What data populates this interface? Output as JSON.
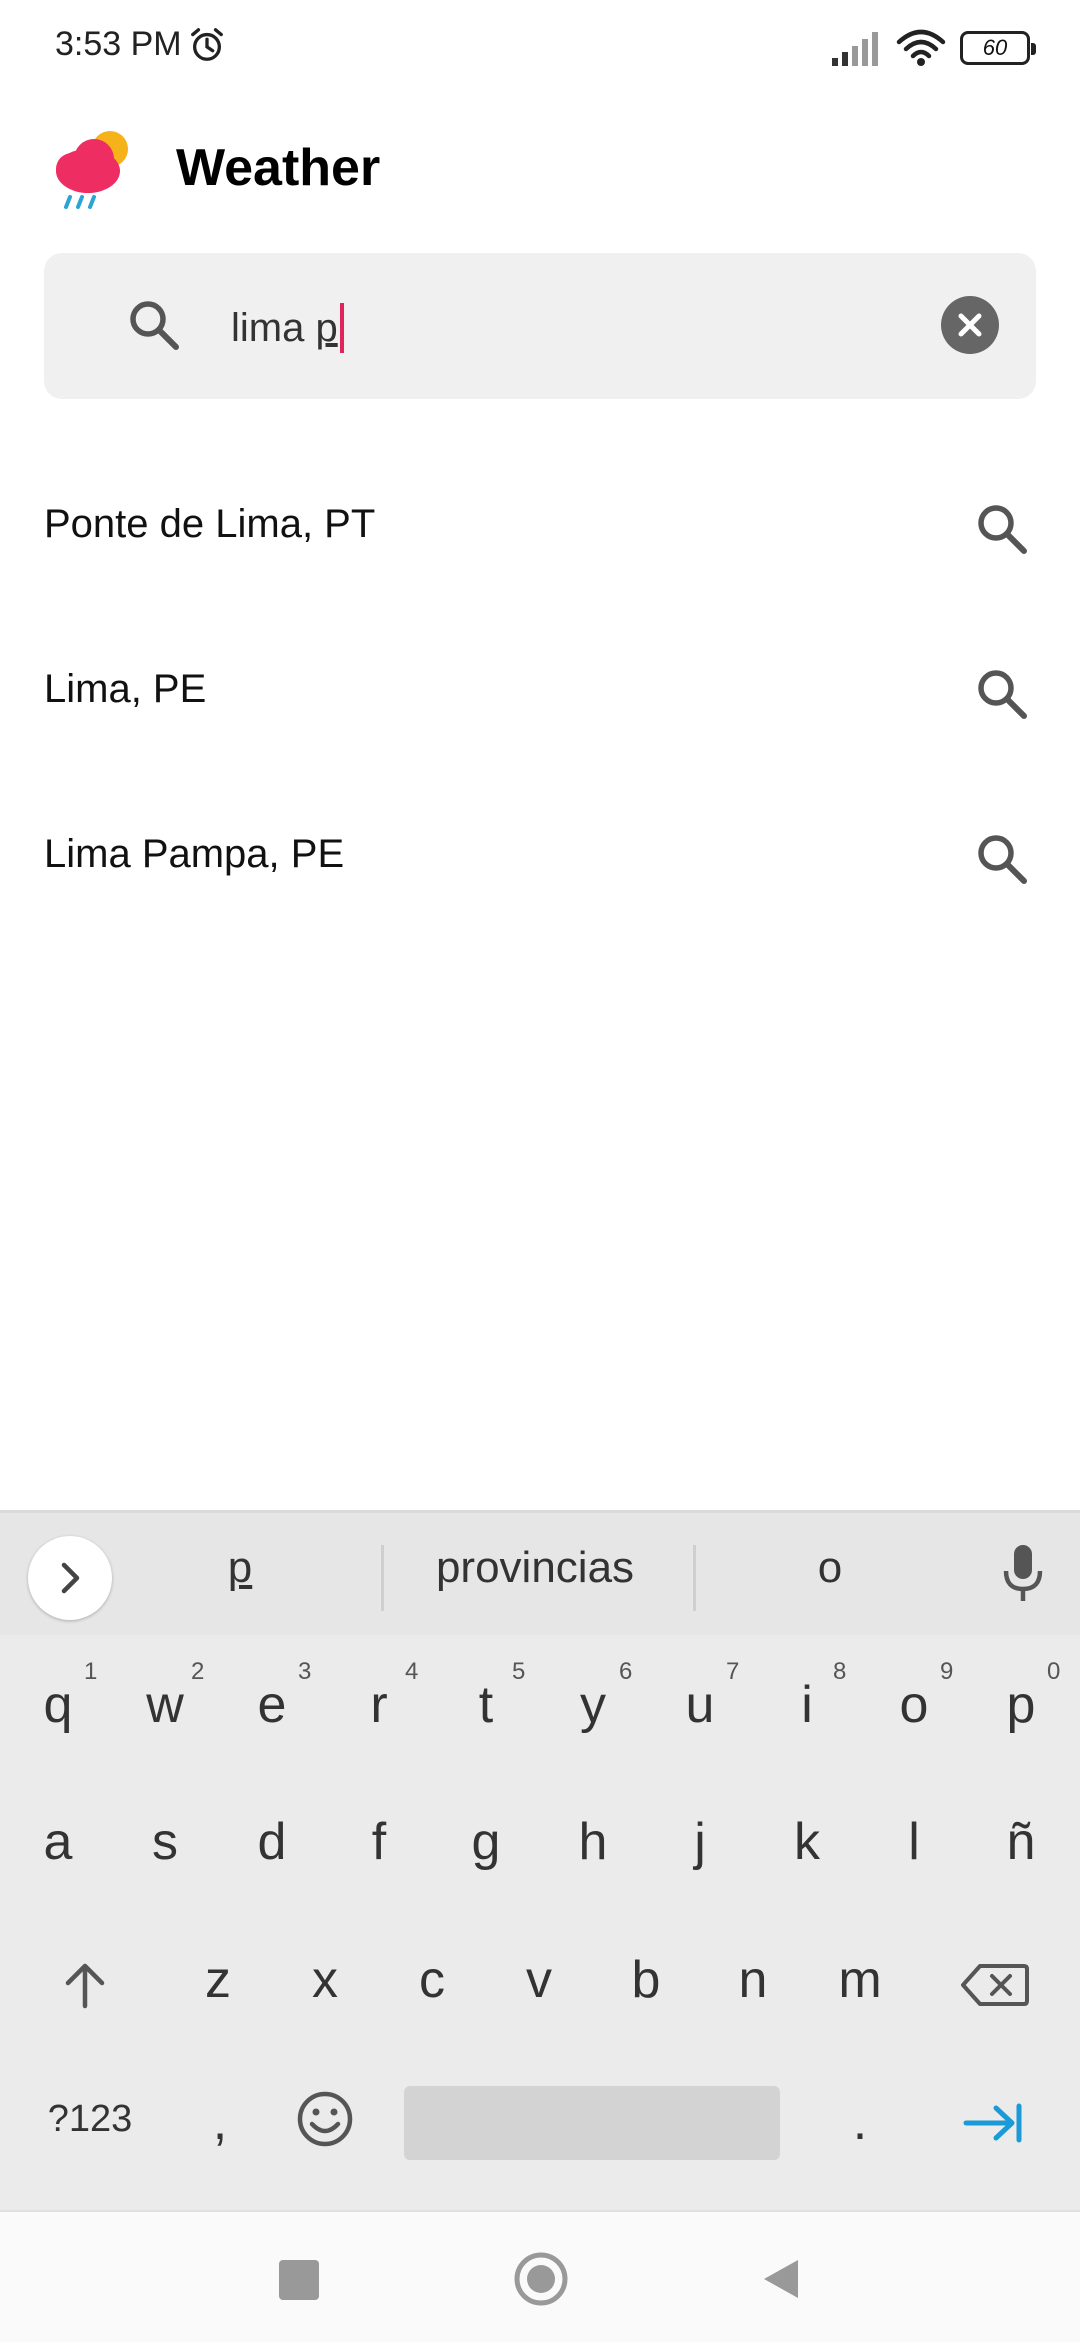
{
  "status_bar": {
    "time": "3:53 PM",
    "battery": "60"
  },
  "header": {
    "title": "Weather"
  },
  "search": {
    "value": "lima ",
    "value_underlined": "p"
  },
  "results": [
    {
      "label": "Ponte de Lima, PT"
    },
    {
      "label": "Lima, PE"
    },
    {
      "label": "Lima Pampa, PE"
    }
  ],
  "keyboard": {
    "suggestions": [
      "p",
      "provincias",
      "o"
    ],
    "row1": [
      "q",
      "w",
      "e",
      "r",
      "t",
      "y",
      "u",
      "i",
      "o",
      "p"
    ],
    "row1_hints": [
      "1",
      "2",
      "3",
      "4",
      "5",
      "6",
      "7",
      "8",
      "9",
      "0"
    ],
    "row2": [
      "a",
      "s",
      "d",
      "f",
      "g",
      "h",
      "j",
      "k",
      "l",
      "ñ"
    ],
    "row3": [
      "z",
      "x",
      "c",
      "v",
      "b",
      "n",
      "m"
    ],
    "symbols_key": "?123",
    "comma_key": ",",
    "period_key": "."
  },
  "colors": {
    "accent": "#e0245e",
    "enter_blue": "#1a9ad6"
  },
  "icons": [
    "alarm-icon",
    "signal-icon",
    "wifi-icon",
    "battery-icon",
    "weather-logo-icon",
    "search-icon",
    "clear-icon",
    "chevron-right-icon",
    "mic-icon",
    "shift-icon",
    "backspace-icon",
    "emoji-icon",
    "enter-icon",
    "nav-recents-icon",
    "nav-home-icon",
    "nav-back-icon"
  ]
}
